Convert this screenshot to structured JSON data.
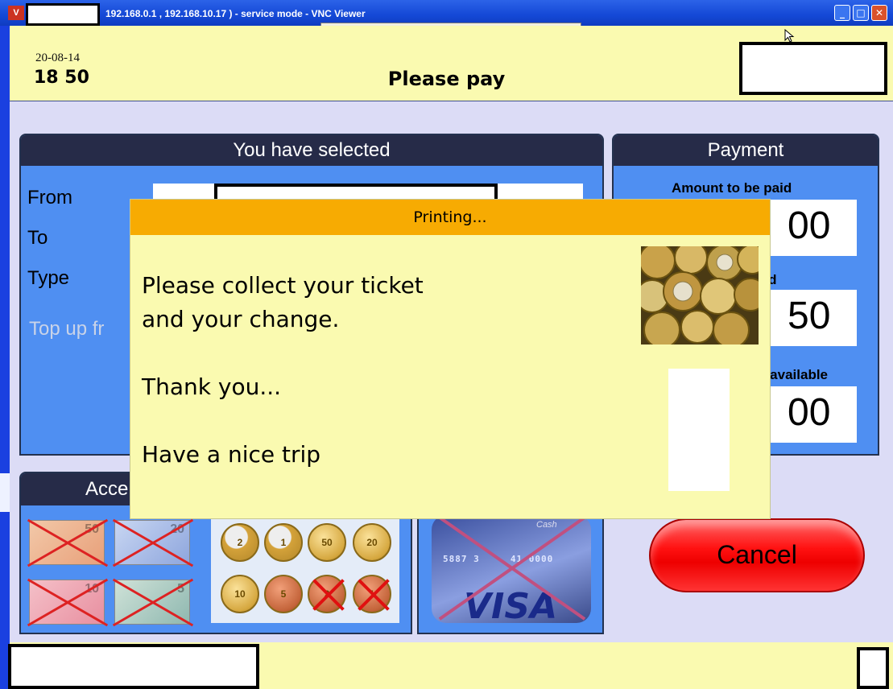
{
  "window": {
    "app_icon_text": "V",
    "title": "192.168.0.1 , 192.168.10.17 ) - service mode - VNC Viewer",
    "controls": {
      "minimize": "_",
      "maximize": "□",
      "close": "✕"
    }
  },
  "header": {
    "date": "20-08-14",
    "time": "18 50",
    "title": "Please pay"
  },
  "selection_panel": {
    "title": "You have selected",
    "rows": {
      "from": "From",
      "to": "To",
      "type": "Type"
    },
    "top_up_text": "Top up fr"
  },
  "payment_panel": {
    "title": "Payment",
    "amount_label": "Amount to be paid",
    "amount_value": "00",
    "paid_label": "aid",
    "paid_value": "50",
    "change_label": "e available",
    "change_value": "00"
  },
  "accepted_panel": {
    "title": "Acce",
    "notes": [
      {
        "value": "50",
        "accepted": false
      },
      {
        "value": "20",
        "accepted": false
      },
      {
        "value": "10",
        "accepted": false
      },
      {
        "value": "5",
        "accepted": false
      }
    ],
    "coins": [
      {
        "value": "2",
        "accepted": true
      },
      {
        "value": "1",
        "accepted": true
      },
      {
        "value": "50",
        "accepted": true
      },
      {
        "value": "20",
        "accepted": true
      },
      {
        "value": "10",
        "accepted": true
      },
      {
        "value": "5",
        "accepted": true
      },
      {
        "value": "2",
        "accepted": false
      },
      {
        "value": "1",
        "accepted": false
      }
    ]
  },
  "card": {
    "brand": "VISA",
    "number_fragment": "5887 3",
    "number_end": "41 0000",
    "label": "Cash",
    "accepted": false
  },
  "cancel_button": "Cancel",
  "dialog": {
    "title": "Printing...",
    "line1": "Please collect your ticket",
    "line2": "and your change.",
    "thanks": "Thank you...",
    "farewell": "Have a nice trip"
  },
  "colors": {
    "header_bg": "#fafab0",
    "panel_blue": "#4f8ff2",
    "panel_head": "#262b48",
    "dialog_head": "#f7ab02",
    "cancel_red": "#ee0000"
  }
}
